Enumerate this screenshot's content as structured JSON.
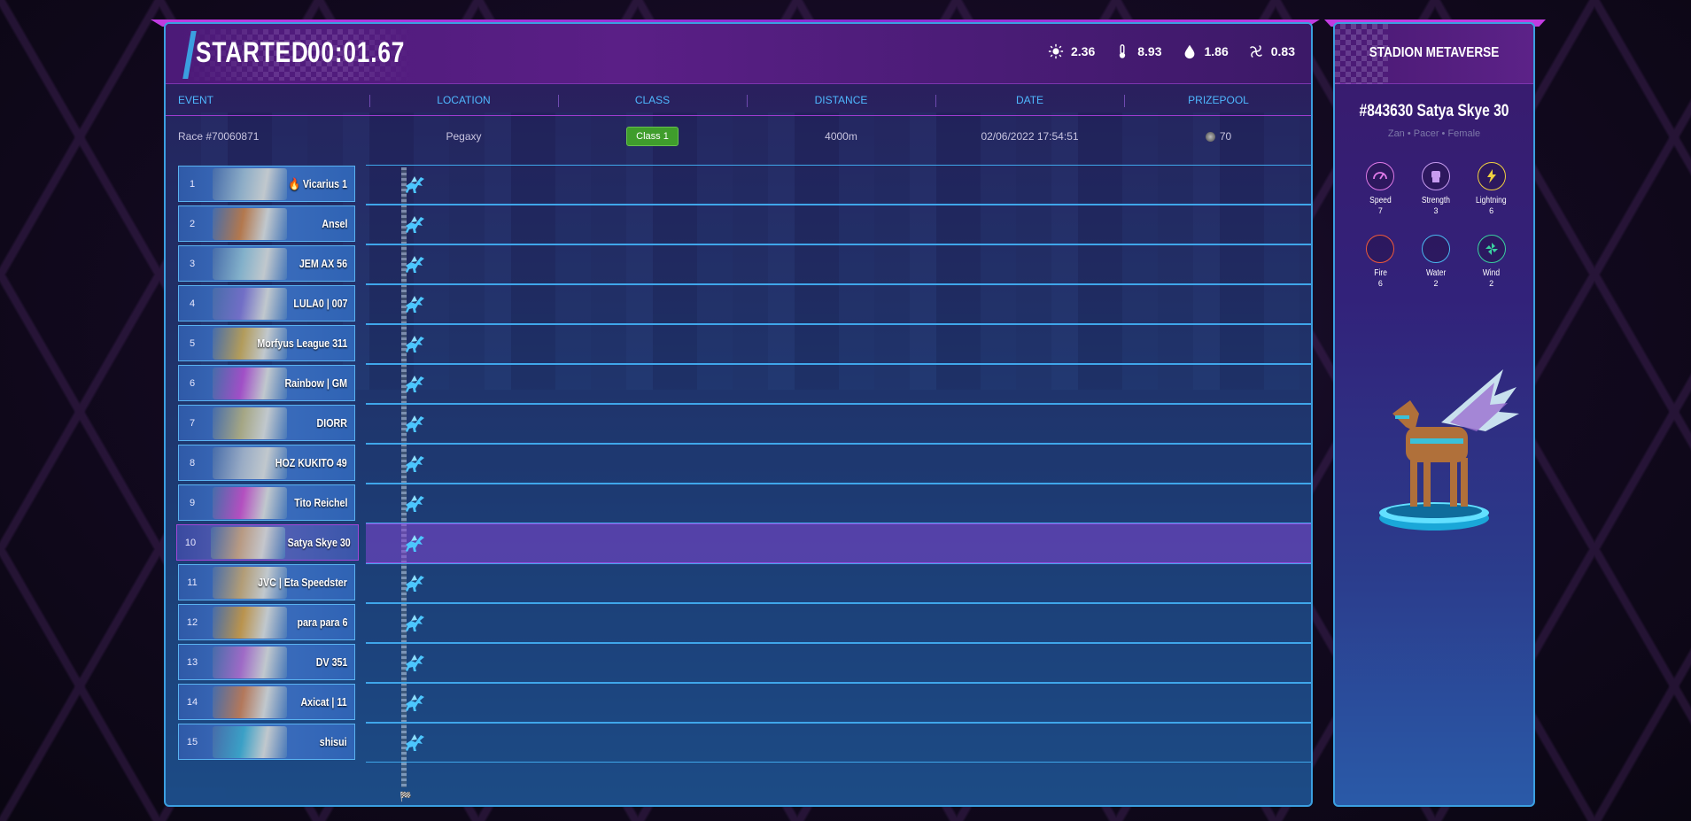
{
  "race": {
    "status": "STARTED",
    "timer": "00:01.67",
    "weather": [
      {
        "icon": "sun-icon",
        "value": "2.36"
      },
      {
        "icon": "thermometer-icon",
        "value": "8.93"
      },
      {
        "icon": "water-drop-icon",
        "value": "1.86"
      },
      {
        "icon": "wind-icon",
        "value": "0.83"
      }
    ]
  },
  "columns": [
    "EVENT",
    "LOCATION",
    "CLASS",
    "DISTANCE",
    "DATE",
    "PRIZEPOOL"
  ],
  "info": {
    "event": "Race #70060871",
    "location": "Pegaxy",
    "class": "Class 1",
    "distance": "4000m",
    "date": "02/06/2022 17:54:51",
    "prizepool": "70"
  },
  "horses": [
    {
      "num": "1",
      "name": "🔥 Vicarius 1",
      "color": "#9ab7c8"
    },
    {
      "num": "2",
      "name": "Ansel",
      "color": "#c87a3a"
    },
    {
      "num": "3",
      "name": "JEM AX 56",
      "color": "#8fbccc"
    },
    {
      "num": "4",
      "name": "LULA0 | 007",
      "color": "#7b6fc8"
    },
    {
      "num": "5",
      "name": "Morfyus League 311",
      "color": "#c7a44a"
    },
    {
      "num": "6",
      "name": "Rainbow | GM",
      "color": "#b24ac8"
    },
    {
      "num": "7",
      "name": "DIORR",
      "color": "#b7b07a"
    },
    {
      "num": "8",
      "name": "HOZ KUKITO 49",
      "color": "#a9b6c6"
    },
    {
      "num": "9",
      "name": "Tito Reichel",
      "color": "#c84ac0"
    },
    {
      "num": "10",
      "name": "Satya Skye 30",
      "color": "#c9a47a",
      "selected": true
    },
    {
      "num": "11",
      "name": "JVC | Eta Speedster",
      "color": "#c7a56a"
    },
    {
      "num": "12",
      "name": "para para 6",
      "color": "#d09a3a"
    },
    {
      "num": "13",
      "name": "DV 351",
      "color": "#b06ac8"
    },
    {
      "num": "14",
      "name": "Axicat | 11",
      "color": "#c87a4a"
    },
    {
      "num": "15",
      "name": "shisui",
      "color": "#3aa9c8"
    }
  ],
  "side": {
    "title": "STADION METAVERSE",
    "horse_name": "#843630 Satya Skye 30",
    "meta": "Zan • Pacer • Female",
    "stats": [
      {
        "label": "Speed",
        "value": "7",
        "icon": "speedometer-icon",
        "color": "#e07ae8"
      },
      {
        "label": "Strength",
        "value": "3",
        "icon": "fist-icon",
        "color": "#c79cf0"
      },
      {
        "label": "Lightning",
        "value": "6",
        "icon": "lightning-icon",
        "color": "#f0d040"
      },
      {
        "label": "Fire",
        "value": "6",
        "icon": "fire-icon",
        "color": "#f05a3a"
      },
      {
        "label": "Water",
        "value": "2",
        "icon": "water-icon",
        "color": "#4ab8f0"
      },
      {
        "label": "Wind",
        "value": "2",
        "icon": "wind-icon",
        "color": "#3ad0a0"
      }
    ]
  }
}
